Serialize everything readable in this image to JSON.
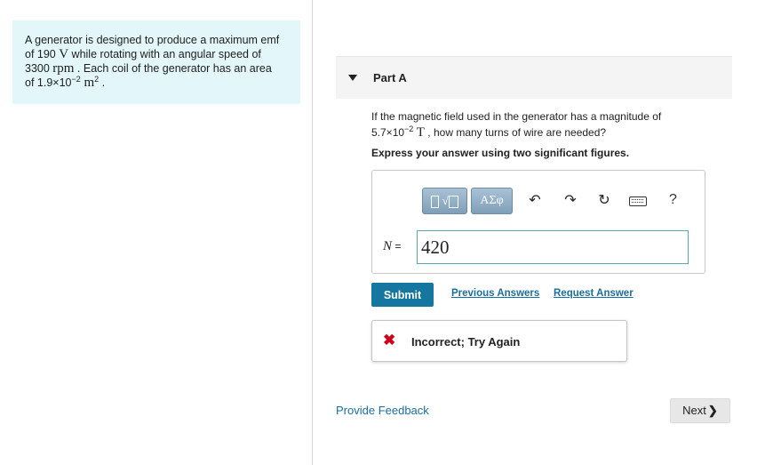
{
  "problem": {
    "line1": "A generator is designed to produce a maximum emf",
    "line2_pre": "of 190 ",
    "line2_unit": "V",
    "line2_post": " while rotating with an angular speed of",
    "line3_pre": "3300 ",
    "line3_unit": "rpm",
    "line3_post": " . Each coil of the generator has an area",
    "line4_pre": "of 1.9×10",
    "line4_exp": "−2",
    "line4_unit": " m",
    "line4_unit_exp": "2",
    "line4_post": " ."
  },
  "part": {
    "title": "Part A"
  },
  "question": {
    "line1": "If the magnetic field used in the generator has a magnitude of",
    "line2_pre": "5.7×10",
    "line2_exp": "−2",
    "line2_unit": " T",
    "line2_post": " , how many turns of wire are needed?",
    "instruction": "Express your answer using two significant figures."
  },
  "toolbar": {
    "templates_icon": "templates-icon",
    "symbols_label": "ΑΣφ",
    "undo_glyph": "↶",
    "redo_glyph": "↷",
    "reset_glyph": "↻",
    "help_label": "?"
  },
  "answer": {
    "variable": "N",
    "equals": " = ",
    "value": "420"
  },
  "actions": {
    "submit_label": "Submit",
    "previous_answers_label": "Previous Answers",
    "request_answer_label": "Request Answer"
  },
  "feedback": {
    "icon": "✖",
    "text": "Incorrect; Try Again"
  },
  "footer": {
    "provide_feedback_label": "Provide Feedback",
    "next_label": "Next",
    "next_chevron": "❯"
  },
  "colors": {
    "problem_bg": "#e3f6f9",
    "submit_bg": "#1576a0",
    "link": "#1a6e9e",
    "incorrect": "#d0021b"
  }
}
